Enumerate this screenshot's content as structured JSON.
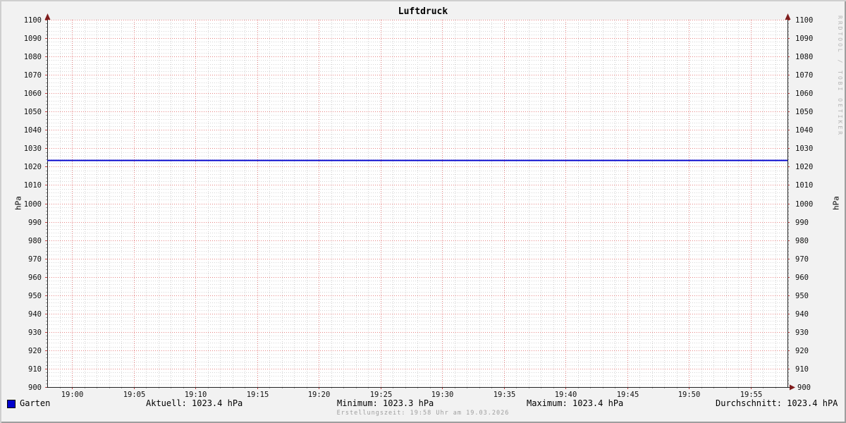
{
  "title": "Luftdruck",
  "watermark": "RRDTOOL / TOBI OETIKER",
  "axis": {
    "ylabel_left": "hPa",
    "ylabel_right": "hPa"
  },
  "chart_data": {
    "type": "line",
    "title": "Luftdruck",
    "ylabel": "hPa",
    "ylabel_right": "hPa",
    "ylim": [
      900,
      1100
    ],
    "y_major_step": 10,
    "y_minor_step": 2,
    "x_range_minutes": 60,
    "x_start_time": "18:58",
    "x_end_time": "19:58",
    "x_first_major_offset_min": 2,
    "x_major_step_min": 5,
    "x_minor_step_min": 1,
    "x_tick_labels": [
      "19:00",
      "19:05",
      "19:10",
      "19:15",
      "19:20",
      "19:25",
      "19:30",
      "19:35",
      "19:40",
      "19:45",
      "19:50",
      "19:55"
    ],
    "grid": "on",
    "legend_position": "bottom",
    "series": [
      {
        "name": "Garten",
        "color": "#0000cc",
        "value": 1023.4
      }
    ],
    "stats": {
      "aktuell": 1023.4,
      "minimum": 1023.3,
      "maximum": 1023.4,
      "durchschnitt": 1023.4
    }
  },
  "legend": {
    "series_label": "Garten",
    "swatch_color": "#0000cc",
    "stats": {
      "aktuell": "Aktuell: 1023.4 hPa",
      "minimum": "Minimum: 1023.3 hPa",
      "maximum": "Maximum: 1023.4 hPa",
      "durchschnitt": "Durchschnitt: 1023.4 hPA"
    }
  },
  "footer": {
    "creation_time": "Erstellungszeit: 19:58 Uhr am 19.03.2026"
  },
  "colors": {
    "background": "#f2f2f2",
    "canvas": "#ffffff",
    "grid_major": "#e58181",
    "grid_minor": "#d4d4d4",
    "axis": "#222222",
    "arrow": "#7f1d1d",
    "series_line": "#0000cc"
  }
}
